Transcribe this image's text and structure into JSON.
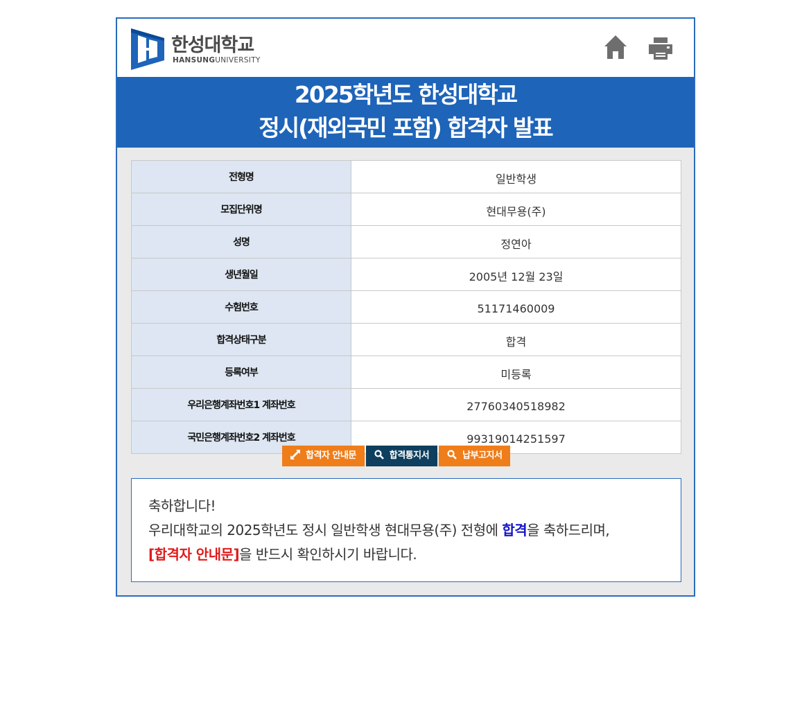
{
  "header": {
    "logo_korean": "한성대학교",
    "logo_english_bold": "HANSUNG",
    "logo_english_rest": "UNIVERSITY",
    "icons": [
      "home-icon",
      "print-icon"
    ]
  },
  "title": {
    "line1": "2025학년도 한성대학교",
    "line2": "정시(재외국민 포함) 합격자 발표"
  },
  "info": {
    "rows": [
      {
        "label": "전형명",
        "value": "일반학생"
      },
      {
        "label": "모집단위명",
        "value": "현대무용(주)"
      },
      {
        "label": "성명",
        "value": "정연아"
      },
      {
        "label": "생년월일",
        "value": "2005년 12월 23일"
      },
      {
        "label": "수험번호",
        "value": "51171460009"
      },
      {
        "label": "합격상태구분",
        "value": "합격"
      },
      {
        "label": "등록여부",
        "value": "미등록"
      },
      {
        "label": "우리은행계좌번호1 계좌번호",
        "value": "27760340518982"
      },
      {
        "label": "국민은행계좌번호2 계좌번호",
        "value": "99319014251597"
      }
    ]
  },
  "buttons": {
    "guide": {
      "label": "합격자 안내문",
      "icon": "expand-icon"
    },
    "notice": {
      "label": "합격통지서",
      "icon": "search-icon"
    },
    "invoice": {
      "label": "납부고지서",
      "icon": "search-icon"
    }
  },
  "colors": {
    "brand_blue": "#1e64b9",
    "button_orange": "#ef7d1a",
    "button_navy": "#0e3f5e",
    "highlight_blue": "#1414c8",
    "highlight_red": "#e01a1a"
  },
  "message": {
    "line1": "축하합니다!",
    "line2_part1": "우리대학교의 2025학년도 정시 일반학생 현대무용(주) 전형에 ",
    "line2_highlight": "합격",
    "line2_part2": "을 축하드리며,",
    "line3_highlight": "[합격자 안내문]",
    "line3_part2": "을 반드시 확인하시기 바랍니다."
  }
}
